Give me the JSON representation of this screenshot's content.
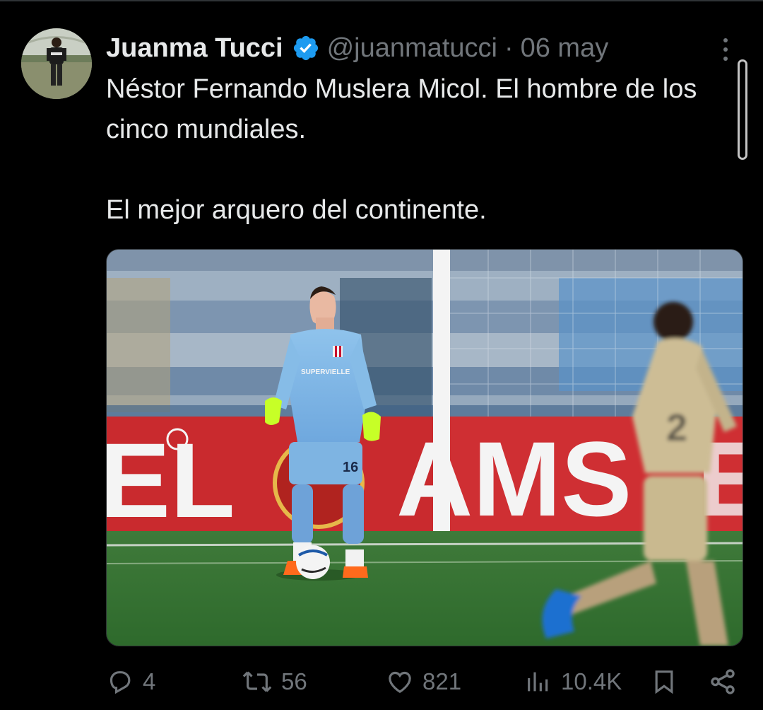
{
  "tweet": {
    "author_name": "Juanma Tucci",
    "handle": "@juanmatucci",
    "separator": "·",
    "date": "06 may",
    "text_line1": "Néstor Fernando Muslera Micol. El hombre de los cinco mundiales.",
    "text_line2": "El mejor arquero del continente."
  },
  "media": {
    "board_text_left": "EL",
    "board_text_right": "AMS",
    "board_text_far": "E",
    "sponsor": "SUPERVIELLE",
    "keeper_number": "16",
    "opponent_number": "2"
  },
  "actions": {
    "replies": "4",
    "reposts": "56",
    "likes": "821",
    "views": "10.4K"
  },
  "colors": {
    "background": "#000000",
    "text": "#e7e9ea",
    "muted": "#71767b",
    "verified": "#1d9bf0"
  },
  "icons": [
    "verified-badge-icon",
    "more-icon",
    "reply-icon",
    "repost-icon",
    "like-icon",
    "views-icon",
    "bookmark-icon",
    "share-icon"
  ]
}
